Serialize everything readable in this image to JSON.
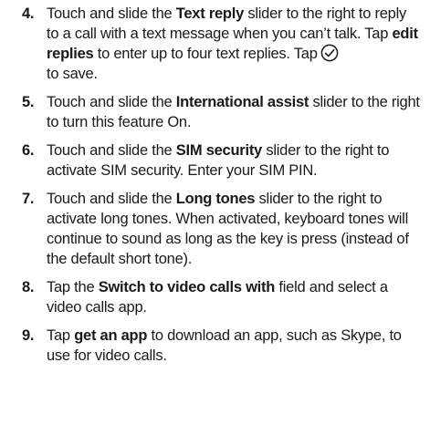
{
  "steps": [
    {
      "number": "4.",
      "parts": [
        "Touch and slide the ",
        "Text reply",
        " slider to the right to reply to a call with a text message when you can’t talk. Tap ",
        "edit replies",
        " to enter up to four text replies. Tap",
        " to save."
      ],
      "icon": "check-circle-icon"
    },
    {
      "number": "5.",
      "parts": [
        "Touch and slide the ",
        "International assist",
        " slider to the right to turn this feature On."
      ]
    },
    {
      "number": "6.",
      "parts": [
        "Touch and slide the ",
        "SIM security",
        " slider to the right to activate SIM security. Enter your SIM PIN."
      ]
    },
    {
      "number": "7.",
      "parts": [
        "Touch and slide the ",
        "Long tones",
        " slider to the right to activate long tones. When activated, keyboard tones will continue to sound as long as the key is press (instead of the default short tone)."
      ]
    },
    {
      "number": "8.",
      "parts": [
        "Tap the ",
        "Switch to video calls with",
        " field and select a video calls app."
      ]
    },
    {
      "number": "9.",
      "parts": [
        "Tap ",
        "get an app",
        " to download an app, such as Skype, to use for video calls."
      ]
    }
  ]
}
